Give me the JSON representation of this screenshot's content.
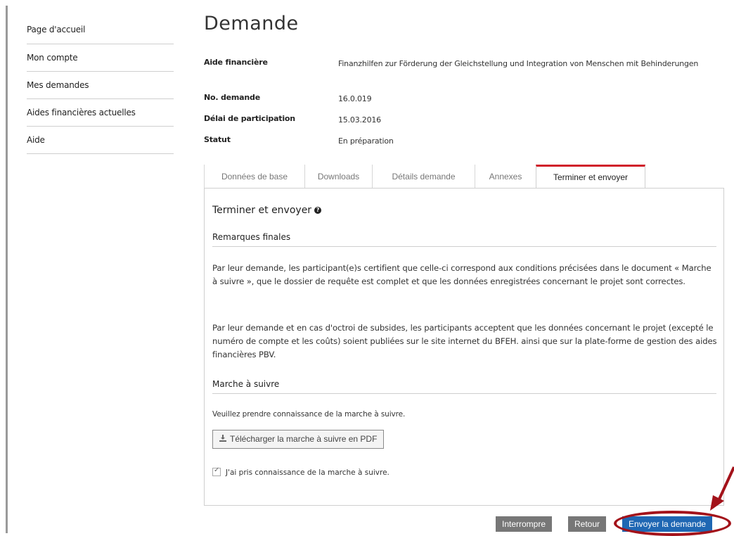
{
  "sidebar": {
    "items": [
      {
        "label": "Page d'accueil"
      },
      {
        "label": "Mon compte"
      },
      {
        "label": "Mes demandes"
      },
      {
        "label": "Aides financières actuelles"
      },
      {
        "label": "Aide"
      }
    ]
  },
  "page": {
    "title": "Demande"
  },
  "info": {
    "aid_label": "Aide financière",
    "aid_value": "Finanzhilfen zur Förderung der Gleichstellung und Integration von Menschen mit Behinderungen",
    "number_label": "No. demande",
    "number_value": "16.0.019",
    "deadline_label": "Délai de participation",
    "deadline_value": "15.03.2016",
    "status_label": "Statut",
    "status_value": "En préparation"
  },
  "tabs": [
    {
      "label": "Données de base"
    },
    {
      "label": "Downloads"
    },
    {
      "label": "Détails demande"
    },
    {
      "label": "Annexes"
    },
    {
      "label": "Terminer et envoyer",
      "active": true
    }
  ],
  "panel": {
    "title": "Terminer et envoyer",
    "info_icon": "question-circle-icon",
    "remarks_heading": "Remarques finales",
    "paragraph1": "Par leur demande, les participant(e)s certifient que celle-ci correspond aux conditions précisées dans le document « Marche à suivre », que le dossier de requête est complet et que les données enregistrées concernant le projet sont correctes.",
    "paragraph2": "Par leur demande et en cas d'octroi de subsides, les participants acceptent que les données concernant le projet (excepté le numéro de compte et les coûts) soient publiées sur le site internet du BFEH. ainsi que sur la plate-forme de gestion des aides financières PBV.",
    "guide_heading": "Marche à suivre",
    "guide_text": "Veuillez prendre connaissance de la marche à suivre.",
    "download_label": "Télécharger la marche à suivre en PDF",
    "download_icon": "download-icon",
    "checkbox_label": "J'ai pris connaissance de la marche à suivre.",
    "checkbox_checked": true
  },
  "actions": {
    "interrupt_label": "Interrompre",
    "back_label": "Retour",
    "send_label": "Envoyer la demande"
  },
  "colors": {
    "accent_red": "#d0202a",
    "primary_blue": "#1f67b3",
    "annotation_red": "#a3121a",
    "button_gray": "#777777"
  }
}
